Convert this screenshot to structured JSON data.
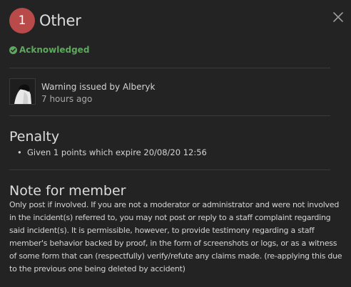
{
  "header": {
    "count": "1",
    "title": "Other",
    "close_icon": "close-icon"
  },
  "status": {
    "icon": "check-circle-icon",
    "label": "Acknowledged",
    "color": "#5ea85e"
  },
  "issuer": {
    "line1": "Warning issued by Alberyk",
    "line2": "7 hours ago"
  },
  "penalty": {
    "title": "Penalty",
    "items": [
      "Given 1 points which expire 20/08/20 12:56"
    ]
  },
  "note": {
    "title": "Note for member",
    "body": "Only post if involved. If you are not a moderator or administrator and were not involved in the incident(s) referred to, you may not post or reply to a staff complaint regarding said incident(s). It is permissible, however, to provide testimony regarding a staff member's behavior backed by proof, in the form of screenshots or logs, or as a witness of some form that can (respectfully) verify/refute any claims made. (re-applying this due to the previous one being deleted by accident)"
  },
  "colors": {
    "background": "#232323",
    "badge": "#b84a4a",
    "acknowledged": "#5ea85e"
  }
}
